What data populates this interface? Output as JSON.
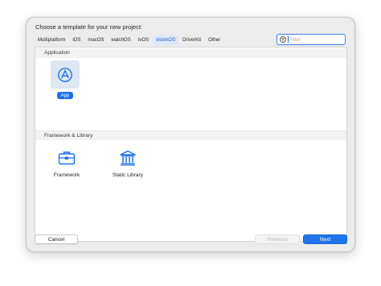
{
  "dialog": {
    "title": "Choose a template for your new project:"
  },
  "tabs": [
    {
      "label": "Multiplatform"
    },
    {
      "label": "iOS"
    },
    {
      "label": "macOS"
    },
    {
      "label": "watchOS"
    },
    {
      "label": "tvOS"
    },
    {
      "label": "visionOS",
      "selected": true
    },
    {
      "label": "DriverKit"
    },
    {
      "label": "Other"
    }
  ],
  "filter": {
    "placeholder": "Filter",
    "value": "",
    "icon": "filter-icon"
  },
  "sections": {
    "application": {
      "title": "Application",
      "templates": [
        {
          "label": "App",
          "icon": "app-store-icon",
          "selected": true
        }
      ]
    },
    "framework_library": {
      "title": "Framework & Library",
      "templates": [
        {
          "label": "Framework",
          "icon": "toolbox-icon"
        },
        {
          "label": "Static Library",
          "icon": "building-columns-icon"
        }
      ]
    }
  },
  "buttons": {
    "cancel": "Cancel",
    "previous": "Previous",
    "next": "Next"
  },
  "colors": {
    "accent": "#1e74ea",
    "selected_tab_bg": "#dbe7f7",
    "selected_tile_bg": "#dde6f2"
  }
}
